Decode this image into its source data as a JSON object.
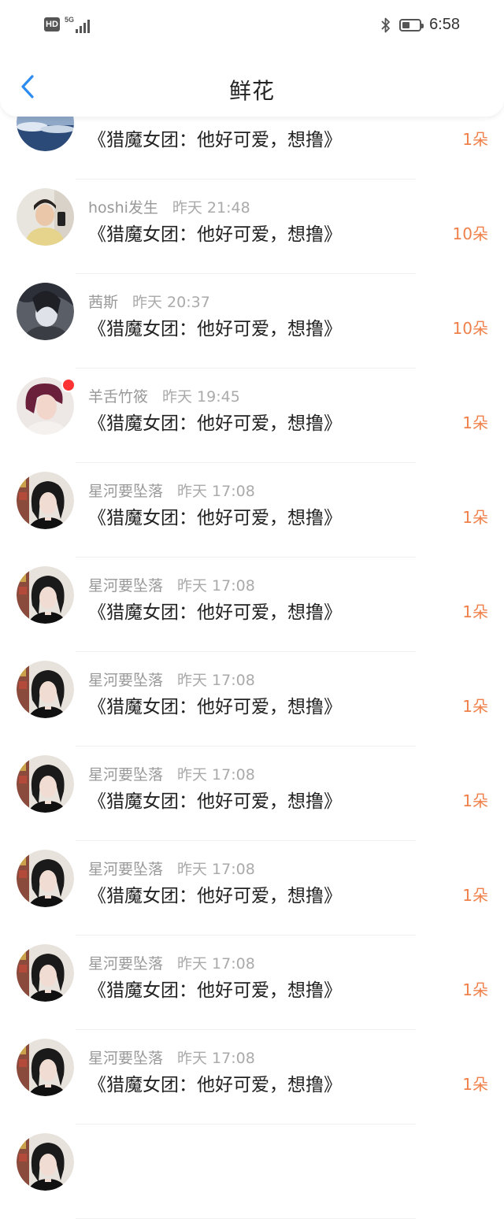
{
  "status_bar": {
    "hd": "HD",
    "network": "5G",
    "time": "6:58",
    "battery_level_percent": 45
  },
  "header": {
    "title": "鲜花",
    "back_icon": "chevron-left-icon",
    "accent_color": "#2d8cf0"
  },
  "items": [
    {
      "user": "",
      "time": "",
      "work": "《猎魔女团：他好可爱，想撸》",
      "count": "1朵",
      "avatar": "sky"
    },
    {
      "user": "hoshi发生",
      "time": "昨天 21:48",
      "work": "《猎魔女团：他好可爱，想撸》",
      "count": "10朵",
      "avatar": "boy"
    },
    {
      "user": "茜斯",
      "time": "昨天 20:37",
      "work": "《猎魔女团：他好可爱，想撸》",
      "count": "10朵",
      "avatar": "dark"
    },
    {
      "user": "羊舌竹筱",
      "time": "昨天 19:45",
      "work": "《猎魔女团：他好可爱，想撸》",
      "count": "1朵",
      "avatar": "girl-red"
    },
    {
      "user": "星河要坠落",
      "time": "昨天 17:08",
      "work": "《猎魔女团：他好可爱，想撸》",
      "count": "1朵",
      "avatar": "girl"
    },
    {
      "user": "星河要坠落",
      "time": "昨天 17:08",
      "work": "《猎魔女团：他好可爱，想撸》",
      "count": "1朵",
      "avatar": "girl"
    },
    {
      "user": "星河要坠落",
      "time": "昨天 17:08",
      "work": "《猎魔女团：他好可爱，想撸》",
      "count": "1朵",
      "avatar": "girl"
    },
    {
      "user": "星河要坠落",
      "time": "昨天 17:08",
      "work": "《猎魔女团：他好可爱，想撸》",
      "count": "1朵",
      "avatar": "girl"
    },
    {
      "user": "星河要坠落",
      "time": "昨天 17:08",
      "work": "《猎魔女团：他好可爱，想撸》",
      "count": "1朵",
      "avatar": "girl"
    },
    {
      "user": "星河要坠落",
      "time": "昨天 17:08",
      "work": "《猎魔女团：他好可爱，想撸》",
      "count": "1朵",
      "avatar": "girl"
    },
    {
      "user": "星河要坠落",
      "time": "昨天 17:08",
      "work": "《猎魔女团：他好可爱，想撸》",
      "count": "1朵",
      "avatar": "girl"
    },
    {
      "user": "",
      "time": "",
      "work": "",
      "count": "",
      "avatar": "girl"
    }
  ]
}
